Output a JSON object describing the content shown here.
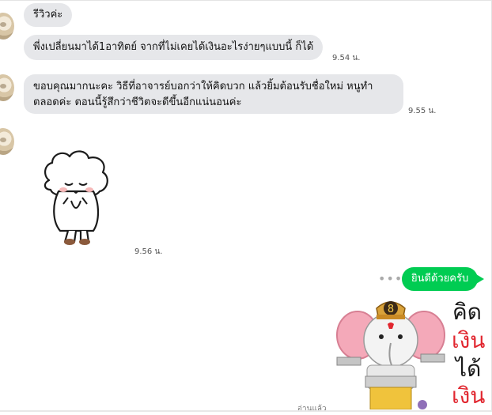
{
  "messages": {
    "m1": {
      "text": "รีวิวค่ะ"
    },
    "m2": {
      "text": "พี่งเปลี่ยนมาได้1อาทิตย์ จากที่ไม่เคยได้เงินอะไรง่ายๆแบบนี้ ก็ได้",
      "time": "9.54 น."
    },
    "m3": {
      "line1": "ขอบคุณมากนะคะ วิธีที่อาจารย์บอกว่าให้คิดบวก แล้วยิ้มต้อนรับชื่อใหม่ หนูทำ",
      "line2": "ตลอดค่ะ ตอนนี้รู้สึกว่าชีวิตจะดีขึ้นอีกแน่นอนค่ะ",
      "time": "9.55 น."
    },
    "m4": {
      "sticker": "sheep-bowing-sticker",
      "time": "9.56 น."
    },
    "reply": {
      "text": "ยินดีด้วยครับ",
      "dots": "•••"
    },
    "reply_sticker": {
      "sticker": "ganesha-sticker",
      "words": [
        "คิด",
        "เงิน",
        "ได้",
        "เงิน"
      ],
      "read_label": "อ่านแล้ว"
    }
  },
  "colors": {
    "incoming_bubble": "#e6e7ea",
    "outgoing_bubble": "#00cc52",
    "sticker_red": "#e1262f"
  }
}
